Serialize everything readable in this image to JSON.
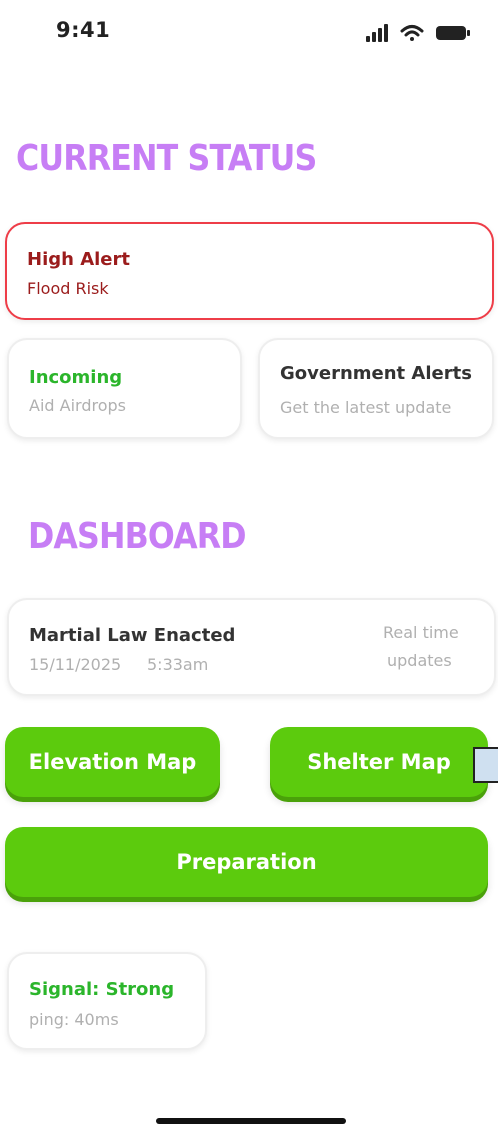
{
  "status_bar": {
    "time": "9:41",
    "icons": [
      "signal-icon",
      "wifi-icon",
      "battery-icon"
    ]
  },
  "current_status": {
    "title": "CURRENT STATUS",
    "alert": {
      "title": "High Alert",
      "subtitle": "Flood Risk"
    },
    "incoming": {
      "title": "Incoming",
      "subtitle": "Aid Airdrops"
    },
    "government": {
      "title": "Government Alerts",
      "subtitle": "Get the latest update"
    }
  },
  "dashboard": {
    "title": "DASHBOARD",
    "news": {
      "title": "Martial Law Enacted",
      "date": "15/11/2025",
      "time": "5:33am",
      "side_line1": "Real time",
      "side_line2": "updates"
    },
    "buttons": {
      "elevation_map": "Elevation Map",
      "shelter_map": "Shelter Map",
      "preparation": "Preparation"
    },
    "signal": {
      "title": "Signal: Strong",
      "ping": "ping: 40ms"
    }
  },
  "colors": {
    "accent_purple": "#c77ef5",
    "alert_red": "#ee3d48",
    "alert_text": "#9b1c1c",
    "green": "#5ccb0d",
    "green_text": "#2bb52b"
  }
}
